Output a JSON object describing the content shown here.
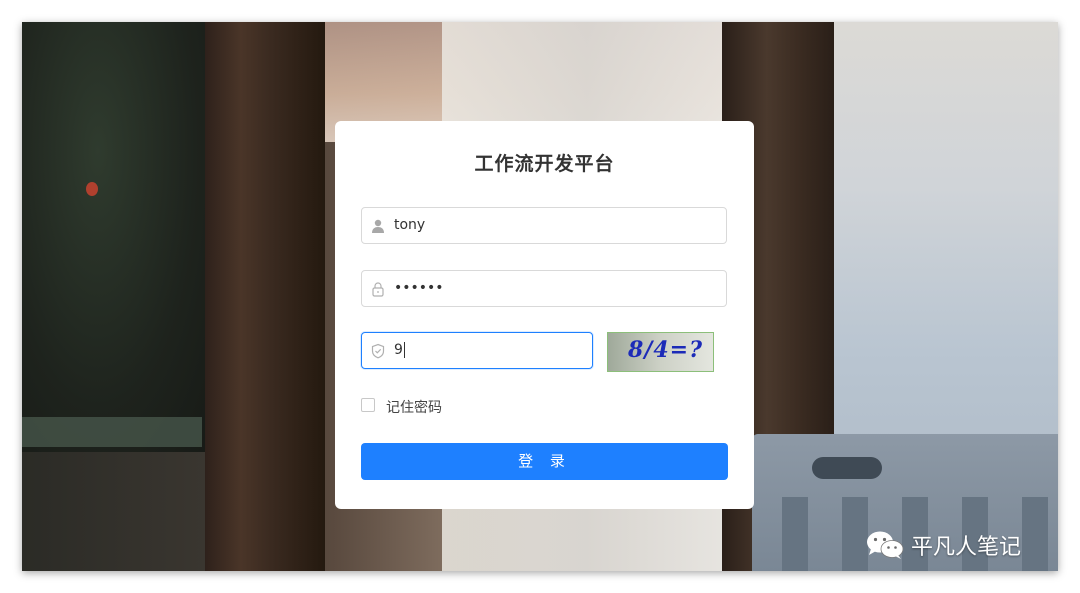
{
  "login_card": {
    "title": "工作流开发平台",
    "username": {
      "value": "tony",
      "icon": "user-icon"
    },
    "password": {
      "value": "••••••",
      "icon": "lock-icon"
    },
    "captcha": {
      "value": "9",
      "icon": "shield-icon",
      "image_text": "8/4=?"
    },
    "remember_label": "记住密码",
    "remember_checked": false,
    "login_label": "登 录"
  },
  "watermark": {
    "text": "平凡人笔记",
    "icon": "wechat-icon"
  },
  "colors": {
    "primary": "#1e80ff",
    "card": "#ffffff",
    "title_text": "#333333"
  }
}
